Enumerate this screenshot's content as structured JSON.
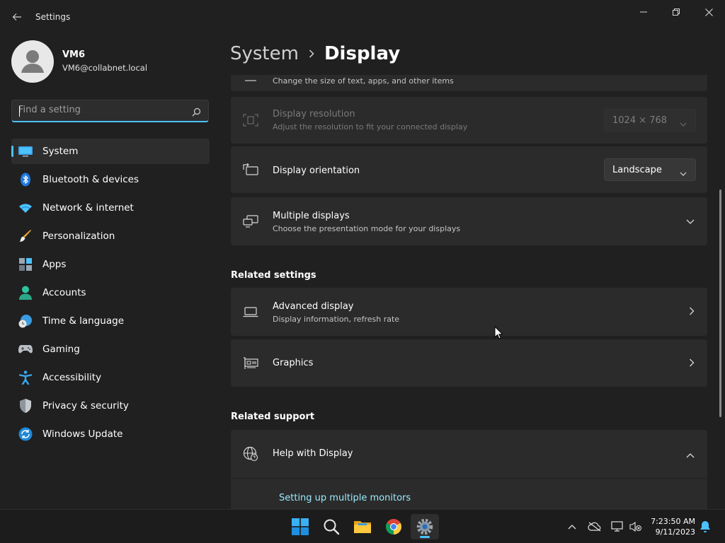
{
  "window": {
    "title": "Settings"
  },
  "profile": {
    "name": "VM6",
    "email": "VM6@collabnet.local"
  },
  "search": {
    "placeholder": "Find a setting"
  },
  "nav": [
    {
      "label": "System",
      "icon": "system-icon",
      "active": true
    },
    {
      "label": "Bluetooth & devices",
      "icon": "bluetooth-icon"
    },
    {
      "label": "Network & internet",
      "icon": "wifi-icon"
    },
    {
      "label": "Personalization",
      "icon": "brush-icon"
    },
    {
      "label": "Apps",
      "icon": "apps-icon"
    },
    {
      "label": "Accounts",
      "icon": "person-icon"
    },
    {
      "label": "Time & language",
      "icon": "globe-clock-icon"
    },
    {
      "label": "Gaming",
      "icon": "gamepad-icon"
    },
    {
      "label": "Accessibility",
      "icon": "accessibility-icon"
    },
    {
      "label": "Privacy & security",
      "icon": "shield-icon"
    },
    {
      "label": "Windows Update",
      "icon": "update-icon"
    }
  ],
  "breadcrumb": {
    "parent": "System",
    "current": "Display"
  },
  "cards": {
    "scale": {
      "subtitle": "Change the size of text, apps, and other items"
    },
    "resolution": {
      "title": "Display resolution",
      "subtitle": "Adjust the resolution to fit your connected display",
      "value": "1024 × 768"
    },
    "orientation": {
      "title": "Display orientation",
      "value": "Landscape"
    },
    "multiple": {
      "title": "Multiple displays",
      "subtitle": "Choose the presentation mode for your displays"
    },
    "advanced": {
      "title": "Advanced display",
      "subtitle": "Display information, refresh rate"
    },
    "graphics": {
      "title": "Graphics"
    },
    "help": {
      "title": "Help with Display",
      "link": "Setting up multiple monitors"
    }
  },
  "sections": {
    "related_settings": "Related settings",
    "related_support": "Related support"
  },
  "taskbar": {
    "time": "7:23:50 AM",
    "date": "9/11/2023"
  },
  "colors": {
    "accent": "#4cc2ff",
    "background": "#202020",
    "card": "#2b2b2b",
    "link": "#99ebff"
  }
}
